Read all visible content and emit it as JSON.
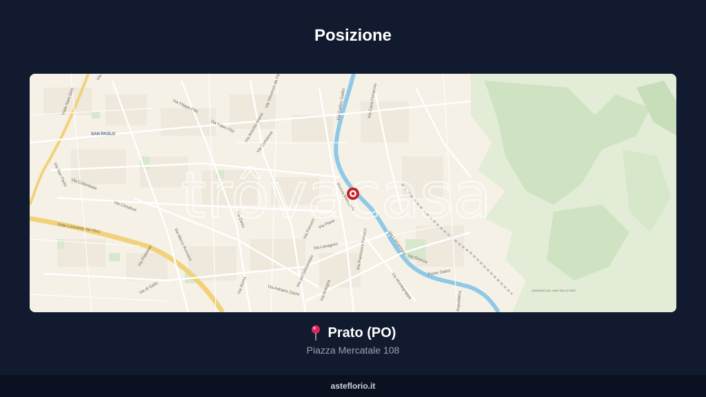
{
  "title": "Posizione",
  "map": {
    "watermark": "trôvacasa",
    "district": "SAN PAOLO",
    "streets": [
      "Viale Nam Dinh",
      "Via Pistoiese",
      "Via Filippo Filzi",
      "Via Fabio Filzi",
      "Via Vincenzo da Filicaia",
      "Via Antonio Marini",
      "Via Curtatone",
      "Via San Paolo",
      "Via Colombaia",
      "Via Cimabue",
      "Viale Leonardo da Vinci",
      "Via Marco Roncioni",
      "Via Zarini",
      "Via Pistoiese",
      "Via Roma",
      "Via Adriano Zarini",
      "Via del Ghirlandaio",
      "Via Bologna",
      "Via Ferrucci",
      "Via Piave",
      "Via Lavagnini",
      "Via Montegrappa",
      "Via Firenze",
      "Ponte Datini",
      "Via Lamarmora",
      "Via Galileo Galilei",
      "Via Cava Pomposa",
      "Via di Gello",
      "Piazza Mercatale",
      "Via Francesco Ferrucci",
      "Repubblica",
      "GIARDINO DEL LIMO DELLE FATE"
    ]
  },
  "location": {
    "city": "Prato (PO)",
    "address": "Piazza Mercatale 108"
  },
  "footer": "asteflorio.it",
  "colors": {
    "background": "#111a2e",
    "footer_bg": "#0b1120",
    "marker": "#c8202a",
    "river": "#8ec9e6",
    "park": "#cfe3c4",
    "highway": "#f1d27a"
  }
}
